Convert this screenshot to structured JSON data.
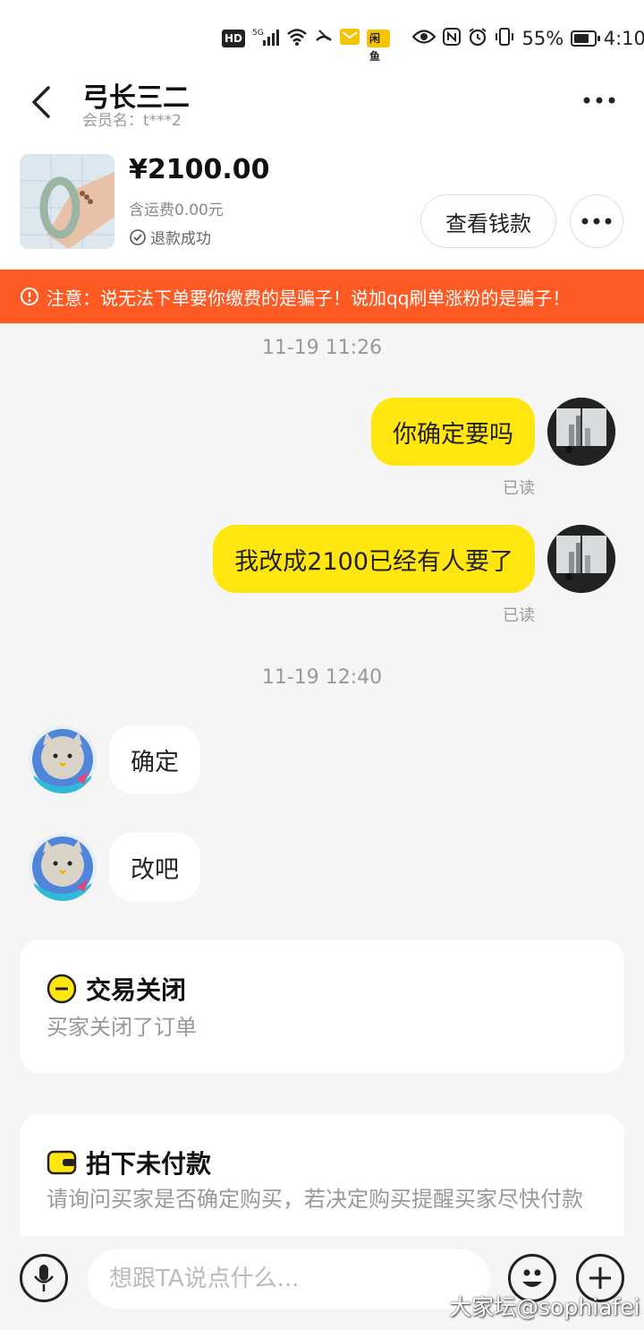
{
  "status_bar": {
    "hd": "HD",
    "net": "5G",
    "battery_pct": "55%",
    "time": "4:10",
    "icons": [
      "hd-icon",
      "signal-icon",
      "wifi-icon",
      "call-muted-icon",
      "mail-icon",
      "app-icon",
      "eye-icon",
      "nfc-icon",
      "alarm-icon",
      "vibrate-icon",
      "battery-icon"
    ],
    "app_badge": "闲鱼"
  },
  "header": {
    "title": "弓长三二",
    "member": "会员名：t***2"
  },
  "product": {
    "price": "¥2100.00",
    "shipping": "含运费0.00元",
    "status": "退款成功",
    "view_button": "查看钱款"
  },
  "warning": {
    "text": "注意：说无法下单要你缴费的是骗子！说加qq刷单涨粉的是骗子！"
  },
  "chat": {
    "timestamp1": "11-19 11:26",
    "msg1": "你确定要吗",
    "read1": "已读",
    "msg2": "我改成2100已经有人要了",
    "read2": "已读",
    "timestamp2": "11-19 12:40",
    "msg3": "确定",
    "msg4": "改吧"
  },
  "card_closed": {
    "title": "交易关闭",
    "subtitle": "买家关闭了订单"
  },
  "card_unpaid": {
    "title": "拍下未付款",
    "subtitle": "请询问买家是否确定购买，若决定购买提醒买家尽快付款"
  },
  "input_bar": {
    "placeholder": "想跟TA说点什么..."
  },
  "watermark": "大家坛@sophiafei",
  "colors": {
    "accent_yellow": "#ffe60f",
    "warning_orange": "#ff5a23",
    "background": "#f5f5f5"
  }
}
